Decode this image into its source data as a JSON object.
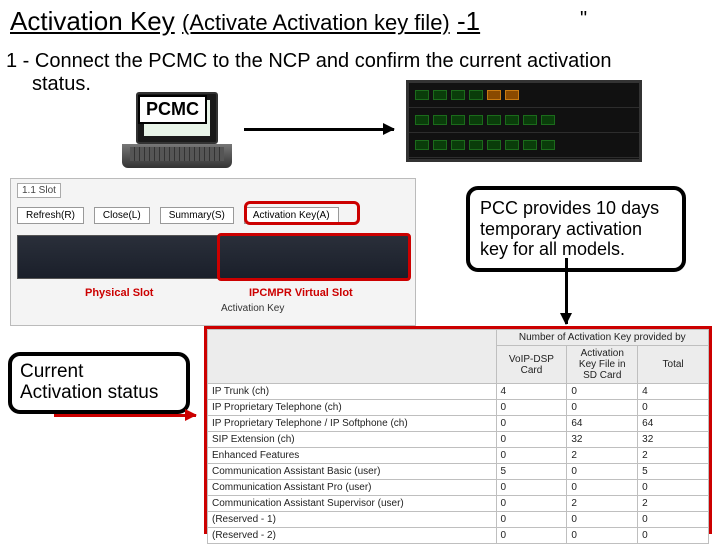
{
  "title": {
    "main": "Activation Key",
    "sub": "(Activate Activation key file)",
    "num": "-1"
  },
  "topQuote": "\"",
  "step": {
    "line1": "1 - Connect the PCMC to the NCP and confirm the current activation",
    "line2": "status."
  },
  "pcmcLabel": "PCMC",
  "callout1": "PCC provides 10 days temporary activation key for all models.",
  "callout2": {
    "l1": "Current",
    "l2": "Activation status"
  },
  "ss1": {
    "slotTitle": "1.1 Slot",
    "buttons": [
      "Refresh(R)",
      "Close(L)",
      "Summary(S)",
      "Activation Key(A)"
    ],
    "redLabel1": "Physical Slot",
    "redLabel2": "IPCMPR Virtual Slot",
    "akLabel": "Activation Key"
  },
  "table": {
    "headerGroup": "Number of Activation Key provided by",
    "cols": [
      "",
      "VoIP-DSP Card",
      "Activation Key File in SD Card",
      "Total"
    ],
    "rows": [
      [
        "IP Trunk (ch)",
        "4",
        "0",
        "4"
      ],
      [
        "IP Proprietary Telephone (ch)",
        "0",
        "0",
        "0"
      ],
      [
        "IP Proprietary Telephone / IP Softphone (ch)",
        "0",
        "64",
        "64"
      ],
      [
        "SIP Extension (ch)",
        "0",
        "32",
        "32"
      ],
      [
        "Enhanced Features",
        "0",
        "2",
        "2"
      ],
      [
        "Communication Assistant Basic (user)",
        "5",
        "0",
        "5"
      ],
      [
        "Communication Assistant Pro (user)",
        "0",
        "0",
        "0"
      ],
      [
        "Communication Assistant Supervisor (user)",
        "0",
        "2",
        "2"
      ],
      [
        "(Reserved - 1)",
        "0",
        "0",
        "0"
      ],
      [
        "(Reserved - 2)",
        "0",
        "0",
        "0"
      ]
    ]
  }
}
